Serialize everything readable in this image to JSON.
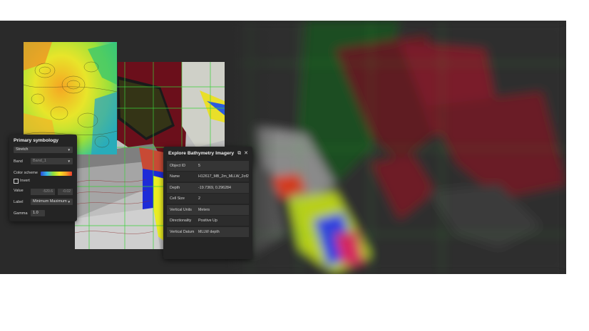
{
  "primary_symbology": {
    "title": "Primary symbology",
    "stretch_type": "Stretch",
    "band_label": "Band",
    "band_value": "Band_1",
    "color_scheme_label": "Color scheme",
    "invert_label": "Invert",
    "value_label": "Value",
    "value_min": "-520.6",
    "value_max": "-0.02",
    "label_label": "Label",
    "label_value": "Minimum Maximum",
    "gamma_label": "Gamma",
    "gamma_value": "1.0"
  },
  "popup": {
    "title": "Explore Bathymetry Imagery",
    "rows": [
      {
        "key": "Object ID",
        "value": "5"
      },
      {
        "key": "Name",
        "value": "H12617_MB_2m_MLLW_2of2"
      },
      {
        "key": "Depth",
        "value": "-19.7369, 0.296284"
      },
      {
        "key": "Cell Size",
        "value": "2"
      },
      {
        "key": "Vertical Units",
        "value": "Meters"
      },
      {
        "key": "Directionality",
        "value": "Positive Up"
      },
      {
        "key": "Vertical Datum",
        "value": "MLLW depth"
      }
    ]
  },
  "colors": {
    "panel_bg": "#242424",
    "row_bg": "#353535",
    "grid_green": "#3ad13a",
    "stage_bg": "#2a2a2a"
  }
}
